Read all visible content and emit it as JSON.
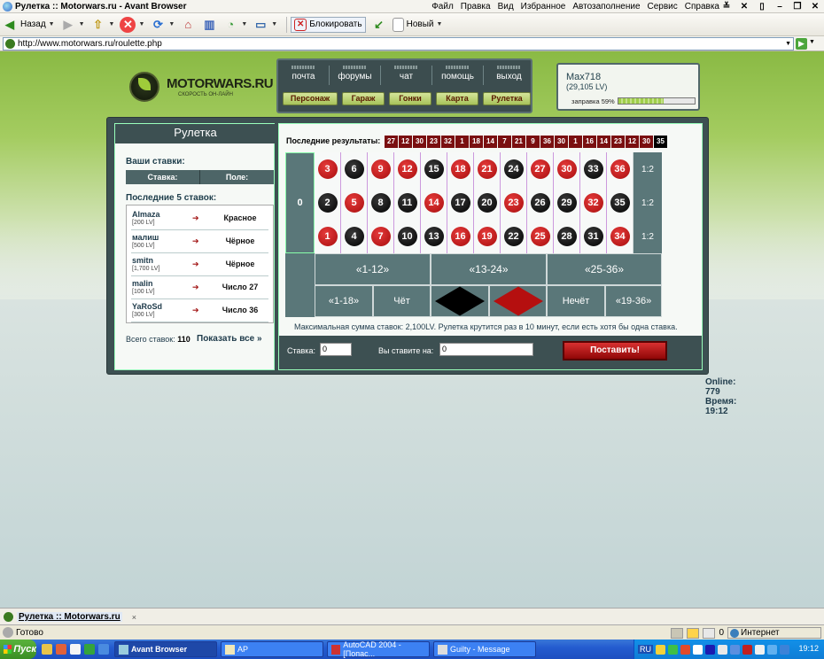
{
  "window": {
    "title": "Рулетка :: Motorwars.ru - Avant Browser"
  },
  "menu": [
    "Файл",
    "Правка",
    "Вид",
    "Избранное",
    "Автозаполнение",
    "Сервис",
    "Справка"
  ],
  "toolbar": {
    "back_label": "Назад",
    "block_label": "Блокировать",
    "new_label": "Новый"
  },
  "address": {
    "url": "http://www.motorwars.ru/roulette.php"
  },
  "site": {
    "logo_text": "MOTORWARS.RU",
    "logo_sub": "СКОРОСТЬ ОН-ЛАЙН",
    "nav_top": [
      "почта",
      "форумы",
      "чат",
      "помощь",
      "выход"
    ],
    "nav_bottom": [
      "Персонаж",
      "Гараж",
      "Гонки",
      "Карта",
      "Рулетка"
    ],
    "user": {
      "name": "Max718",
      "lv": "(29,105 LV)",
      "fuel_label": "заправка 59%",
      "fuel_level": 0.59
    }
  },
  "roulette": {
    "title": "Рулетка",
    "your_bets_label": "Ваши ставки:",
    "bets_header": [
      "Ставка:",
      "Поле:"
    ],
    "last5_label": "Последние 5 ставок:",
    "last5": [
      {
        "name": "Almaza",
        "lv": "[200 LV]",
        "bet": "Красное"
      },
      {
        "name": "малиш",
        "lv": "[500 LV]",
        "bet": "Чёрное"
      },
      {
        "name": "smitn",
        "lv": "[1,700 LV]",
        "bet": "Чёрное"
      },
      {
        "name": "malin",
        "lv": "[100 LV]",
        "bet": "Число 27"
      },
      {
        "name": "YaRoSd",
        "lv": "[300 LV]",
        "bet": "Число 36"
      }
    ],
    "total_label": "Всего ставок:",
    "total_value": "110",
    "show_all": "Показать все »",
    "last_results_label": "Последние результаты:",
    "last_results": [
      {
        "n": "27",
        "c": "red"
      },
      {
        "n": "12",
        "c": "red"
      },
      {
        "n": "30",
        "c": "red"
      },
      {
        "n": "23",
        "c": "red"
      },
      {
        "n": "32",
        "c": "red"
      },
      {
        "n": "1",
        "c": "red"
      },
      {
        "n": "18",
        "c": "red"
      },
      {
        "n": "14",
        "c": "red"
      },
      {
        "n": "7",
        "c": "red"
      },
      {
        "n": "21",
        "c": "red"
      },
      {
        "n": "9",
        "c": "red"
      },
      {
        "n": "36",
        "c": "red"
      },
      {
        "n": "30",
        "c": "red"
      },
      {
        "n": "1",
        "c": "red"
      },
      {
        "n": "16",
        "c": "red"
      },
      {
        "n": "14",
        "c": "red"
      },
      {
        "n": "23",
        "c": "red"
      },
      {
        "n": "12",
        "c": "red"
      },
      {
        "n": "30",
        "c": "red"
      },
      {
        "n": "35",
        "c": "black"
      }
    ],
    "zero": "0",
    "rows": [
      [
        {
          "n": "3",
          "c": "red"
        },
        {
          "n": "6",
          "c": "black"
        },
        {
          "n": "9",
          "c": "red"
        },
        {
          "n": "12",
          "c": "red"
        },
        {
          "n": "15",
          "c": "black"
        },
        {
          "n": "18",
          "c": "red"
        },
        {
          "n": "21",
          "c": "red"
        },
        {
          "n": "24",
          "c": "black"
        },
        {
          "n": "27",
          "c": "red"
        },
        {
          "n": "30",
          "c": "red"
        },
        {
          "n": "33",
          "c": "black"
        },
        {
          "n": "36",
          "c": "red"
        }
      ],
      [
        {
          "n": "2",
          "c": "black"
        },
        {
          "n": "5",
          "c": "red"
        },
        {
          "n": "8",
          "c": "black"
        },
        {
          "n": "11",
          "c": "black"
        },
        {
          "n": "14",
          "c": "red"
        },
        {
          "n": "17",
          "c": "black"
        },
        {
          "n": "20",
          "c": "black"
        },
        {
          "n": "23",
          "c": "red"
        },
        {
          "n": "26",
          "c": "black"
        },
        {
          "n": "29",
          "c": "black"
        },
        {
          "n": "32",
          "c": "red"
        },
        {
          "n": "35",
          "c": "black"
        }
      ],
      [
        {
          "n": "1",
          "c": "red"
        },
        {
          "n": "4",
          "c": "black"
        },
        {
          "n": "7",
          "c": "red"
        },
        {
          "n": "10",
          "c": "black"
        },
        {
          "n": "13",
          "c": "black"
        },
        {
          "n": "16",
          "c": "red"
        },
        {
          "n": "19",
          "c": "red"
        },
        {
          "n": "22",
          "c": "black"
        },
        {
          "n": "25",
          "c": "red"
        },
        {
          "n": "28",
          "c": "black"
        },
        {
          "n": "31",
          "c": "black"
        },
        {
          "n": "34",
          "c": "red"
        }
      ]
    ],
    "column_bet": "1:2",
    "dozens": [
      "«1-12»",
      "«13-24»",
      "«25-36»"
    ],
    "outside": {
      "low": "«1-18»",
      "even": "Чёт",
      "odd": "Нечёт",
      "high": "«19-36»"
    },
    "max_sum_text": "Максимальная сумма ставок: 2,100LV. Рулетка крутится раз в 10 минут, если есть хотя бы одна ставка.",
    "stake_label": "Ставка:",
    "stake_value": "0",
    "you_bet_label": "Вы ставите на:",
    "you_bet_value": "0",
    "place_button": "Поставить!"
  },
  "online": {
    "text": "Online: 779",
    "time": "Время: 19:12"
  },
  "tab": {
    "label": "Рулетка :: Motorwars.ru",
    "close": "×"
  },
  "status": {
    "text": "Готово",
    "counter": "0",
    "zone": "Интернет"
  },
  "taskbar": {
    "start": "Пуск",
    "tasks": [
      "Avant Browser",
      "AP",
      "AutoCAD 2004 - [Попас...",
      "Guilty - Message"
    ],
    "lang": "RU",
    "clock": "19:12"
  },
  "colors": {
    "red": "#a80d0d",
    "black": "#000000",
    "panel": "#3d5052",
    "felt": "#5a7779"
  }
}
